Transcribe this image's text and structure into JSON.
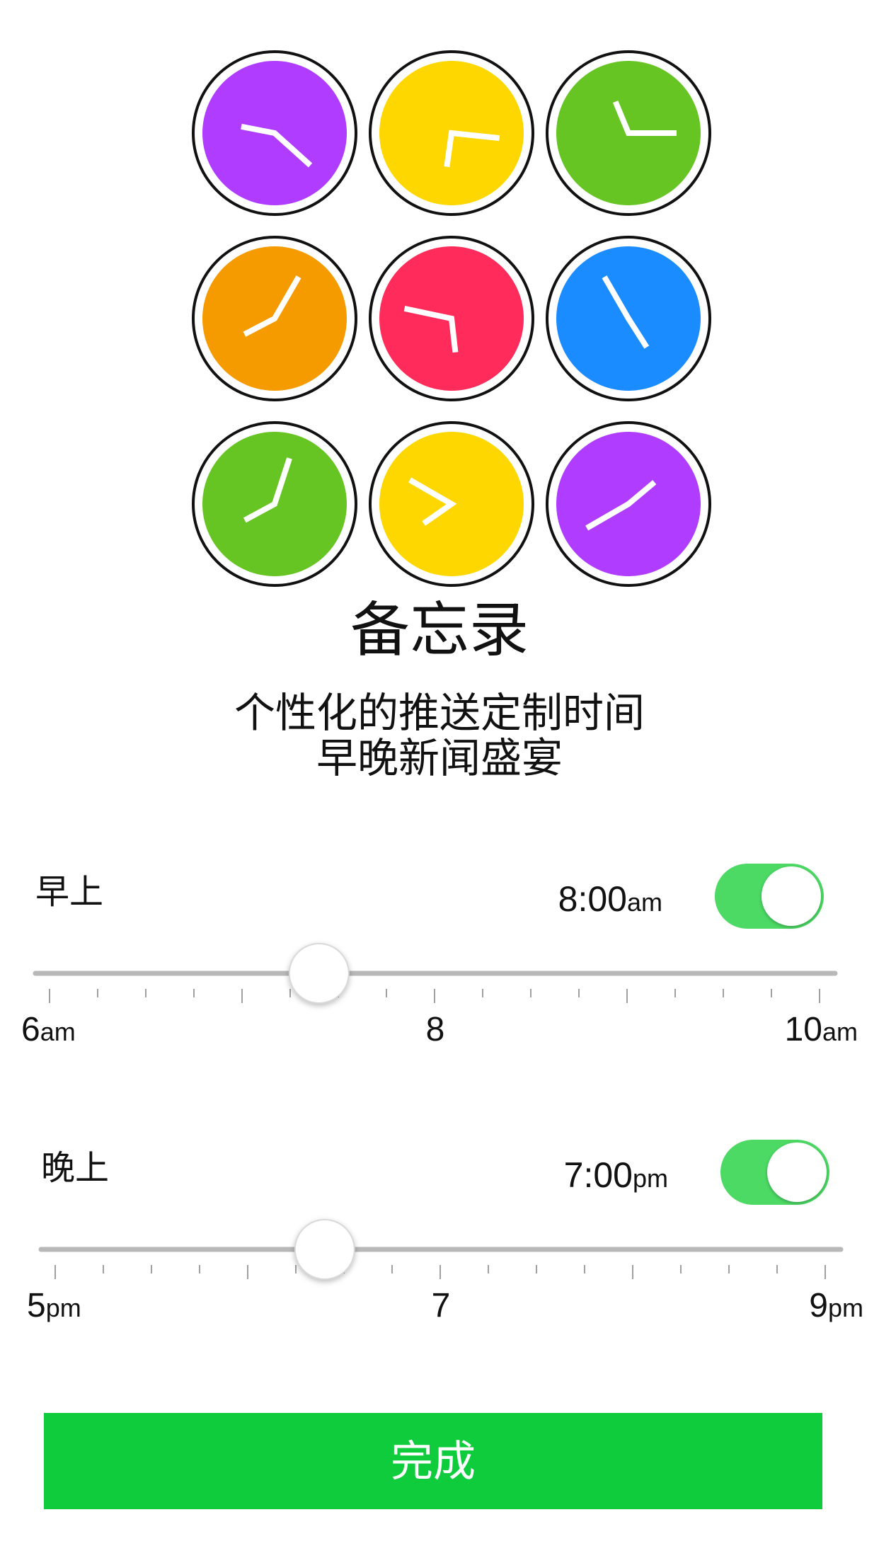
{
  "clocks": [
    {
      "color": "#b03cff",
      "hour": 9,
      "minute": 22
    },
    {
      "color": "#ffd700",
      "hour": 6,
      "minute": 16
    },
    {
      "color": "#66c423",
      "hour": 11,
      "minute": 15
    },
    {
      "color": "#f59b00",
      "hour": 8,
      "minute": 5
    },
    {
      "color": "#ff2b5a",
      "hour": 5,
      "minute": 47
    },
    {
      "color": "#1a8cff",
      "hour": 4,
      "minute": 55
    },
    {
      "color": "#66c423",
      "hour": 8,
      "minute": 3
    },
    {
      "color": "#ffd700",
      "hour": 7,
      "minute": 50
    },
    {
      "color": "#b03cff",
      "hour": 1,
      "minute": 40
    }
  ],
  "title": "备忘录",
  "subtitle_line1": "个性化的推送定制时间",
  "subtitle_line2": "早晚新闻盛宴",
  "morning": {
    "label": "早上",
    "time_value": "8:00",
    "time_suffix": "am",
    "enabled": true,
    "slider": {
      "min_hour": 6,
      "max_hour": 10,
      "value_hour": 7.4,
      "tick_labels": [
        {
          "num": "6",
          "suffix": "am"
        },
        {
          "num": "8",
          "suffix": ""
        },
        {
          "num": "10",
          "suffix": "am"
        }
      ]
    }
  },
  "evening": {
    "label": "晚上",
    "time_value": "7:00",
    "time_suffix": "pm",
    "enabled": true,
    "slider": {
      "min_hour": 5,
      "max_hour": 9,
      "value_hour": 6.4,
      "tick_labels": [
        {
          "num": "5",
          "suffix": "pm"
        },
        {
          "num": "7",
          "suffix": ""
        },
        {
          "num": "9",
          "suffix": "pm"
        }
      ]
    }
  },
  "done_label": "完成",
  "colors": {
    "toggle_on": "#4cd964",
    "button_bg": "#0fcc3d",
    "track": "#b8b8b8",
    "tick": "#a0a0a0"
  }
}
